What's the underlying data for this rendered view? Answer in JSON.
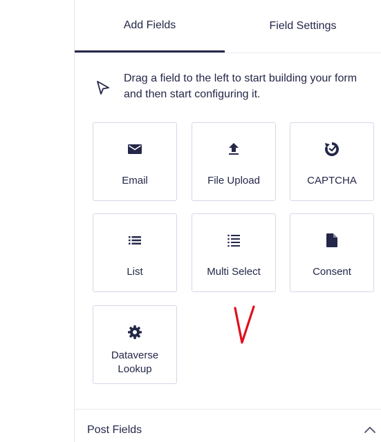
{
  "tabs": [
    {
      "label": "Add Fields",
      "active": true
    },
    {
      "label": "Field Settings",
      "active": false
    }
  ],
  "hint": {
    "text": "Drag a field to the left to start building your form and then start configuring it.",
    "icon": "pointer-icon"
  },
  "fields": [
    {
      "label": "Email",
      "icon": "envelope-icon"
    },
    {
      "label": "File Upload",
      "icon": "upload-icon"
    },
    {
      "label": "CAPTCHA",
      "icon": "captcha-icon"
    },
    {
      "label": "List",
      "icon": "list-icon"
    },
    {
      "label": "Multi Select",
      "icon": "checklist-icon"
    },
    {
      "label": "Consent",
      "icon": "document-icon"
    },
    {
      "label_lines": [
        "Dataverse",
        "Lookup"
      ],
      "icon": "gear-icon"
    }
  ],
  "sections": [
    {
      "label": "Post Fields",
      "icon": "chevron-up-icon"
    }
  ],
  "colors": {
    "text": "#242748",
    "border": "#d5d7e9",
    "annotation": "#e0101e"
  }
}
